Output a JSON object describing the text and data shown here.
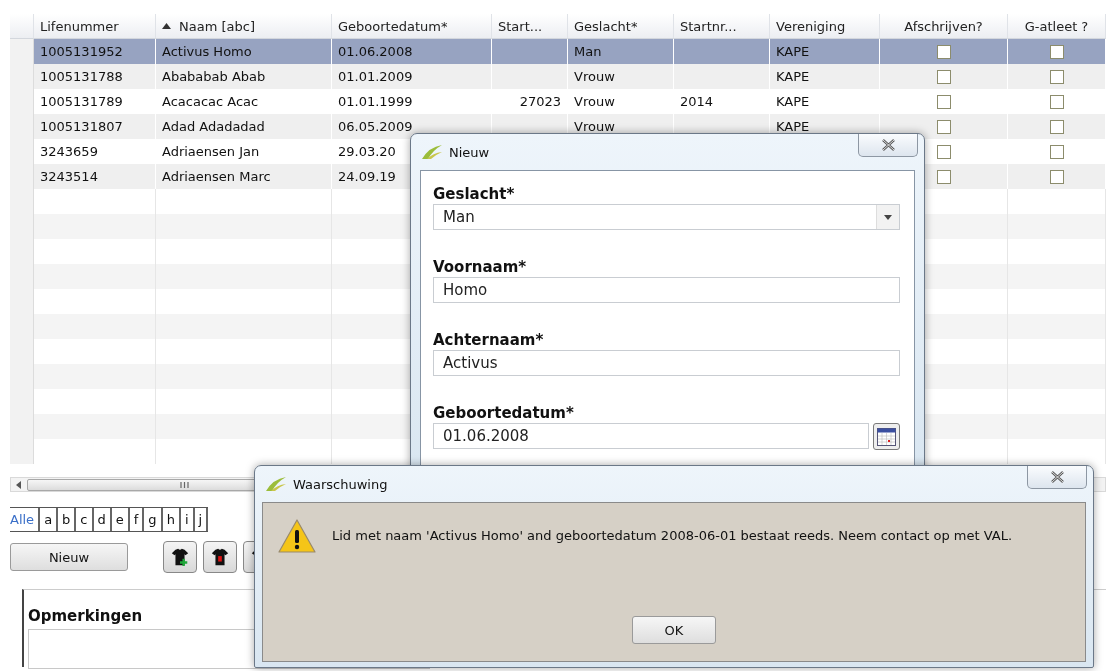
{
  "table": {
    "columns": [
      {
        "label": "Lifenummer",
        "kind": "text",
        "sorted": false
      },
      {
        "label": "Naam [abc]",
        "kind": "text",
        "sorted": true
      },
      {
        "label": "Geboortedatum*",
        "kind": "text",
        "sorted": false
      },
      {
        "label": "Start...",
        "kind": "number",
        "sorted": false
      },
      {
        "label": "Geslacht*",
        "kind": "text",
        "sorted": false
      },
      {
        "label": "Startnr...",
        "kind": "text",
        "sorted": false
      },
      {
        "label": "Vereniging",
        "kind": "text",
        "sorted": false
      },
      {
        "label": "Afschrijven?",
        "kind": "check",
        "sorted": false
      },
      {
        "label": "G-atleet ?",
        "kind": "check",
        "sorted": false
      }
    ],
    "rows": [
      {
        "selected": true,
        "cells": [
          "1005131952",
          "Activus Homo",
          "01.06.2008",
          null,
          "Man",
          null,
          "KAPE"
        ],
        "checks": [
          false,
          false
        ]
      },
      {
        "selected": false,
        "cells": [
          "1005131788",
          "Abababab Abab",
          "01.01.2009",
          null,
          "Vrouw",
          null,
          "KAPE"
        ],
        "checks": [
          false,
          false
        ]
      },
      {
        "selected": false,
        "cells": [
          "1005131789",
          "Acacacac Acac",
          "01.01.1999",
          "27023",
          "Vrouw",
          "2014",
          "KAPE"
        ],
        "checks": [
          false,
          false
        ]
      },
      {
        "selected": false,
        "cells": [
          "1005131807",
          "Adad Adadadad",
          "06.05.2009",
          null,
          "Vrouw",
          null,
          "KAPE"
        ],
        "checks": [
          false,
          false
        ]
      },
      {
        "selected": false,
        "cells": [
          "3243659",
          "Adriaensen Jan",
          "29.03.20"
        ],
        "checks": [
          false,
          false
        ]
      },
      {
        "selected": false,
        "cells": [
          "3243514",
          "Adriaensen Marc",
          "24.09.19"
        ],
        "checks": [
          false,
          false
        ]
      }
    ]
  },
  "letters": [
    {
      "label": "Alle",
      "selected": true
    },
    {
      "label": "a",
      "selected": false
    },
    {
      "label": "b",
      "selected": false
    },
    {
      "label": "c",
      "selected": false
    },
    {
      "label": "d",
      "selected": false
    },
    {
      "label": "e",
      "selected": false
    },
    {
      "label": "f",
      "selected": false
    },
    {
      "label": "g",
      "selected": false
    },
    {
      "label": "h",
      "selected": false
    },
    {
      "label": "i",
      "selected": false
    },
    {
      "label": "j",
      "selected": false
    }
  ],
  "toolbar": {
    "new_button": "Nieuw",
    "icon_buttons": [
      {
        "kind": "shirt-add"
      },
      {
        "kind": "shirt-mark"
      },
      {
        "kind": "shirt"
      }
    ]
  },
  "remarks": {
    "label": "Opmerkingen"
  },
  "new_dialog": {
    "title": "Nieuw",
    "fields": [
      {
        "label": "Geslacht*",
        "kind": "select",
        "value": "Man"
      },
      {
        "label": "Voornaam*",
        "kind": "text",
        "value": "Homo"
      },
      {
        "label": "Achternaam*",
        "kind": "text",
        "value": "Activus"
      },
      {
        "label": "Geboortedatum*",
        "kind": "date",
        "value": "01.06.2008"
      }
    ]
  },
  "warning_dialog": {
    "title": "Waarschuwing",
    "message": "Lid met naam 'Activus Homo' and geboortedatum 2008-06-01 bestaat reeds. Neem contact op met VAL.",
    "button": "OK"
  }
}
